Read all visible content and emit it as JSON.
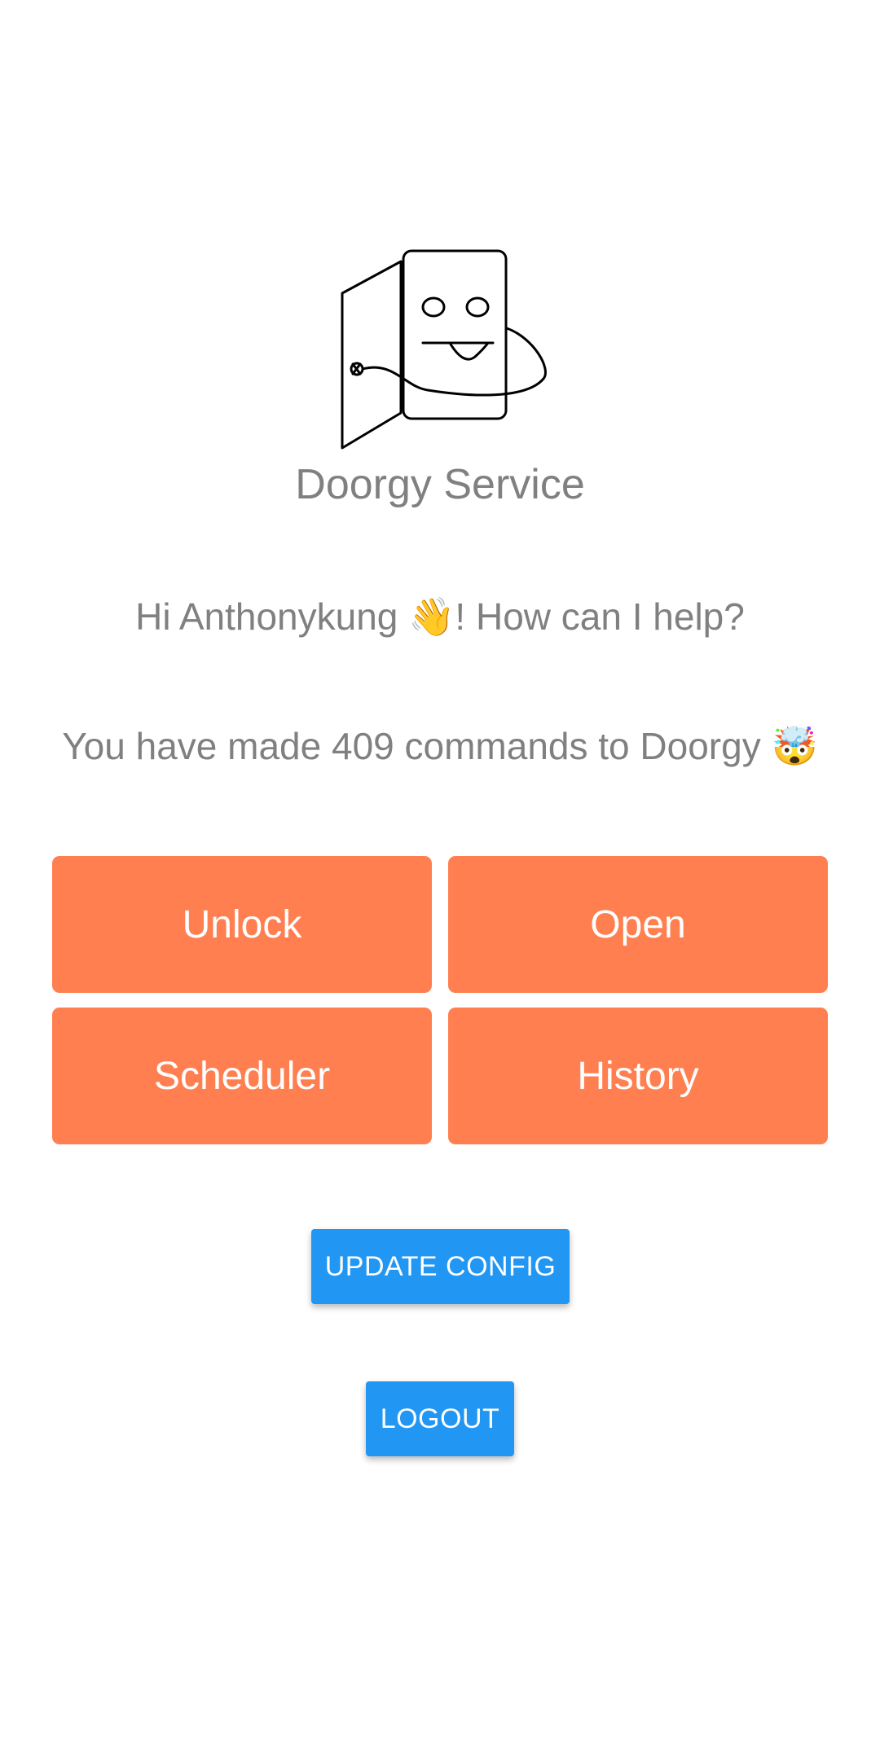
{
  "app": {
    "title": "Doorgy Service",
    "logo_icon": "door-face-logo-icon"
  },
  "greeting": {
    "text": "Hi Anthonykung 👋! How can I help?"
  },
  "stats": {
    "text": "You have made 409 commands to Doorgy 🤯"
  },
  "actions": {
    "unlock_label": "Unlock",
    "open_label": "Open",
    "scheduler_label": "Scheduler",
    "history_label": "History"
  },
  "buttons": {
    "update_config_label": "UPDATE CONFIG",
    "logout_label": "LOGOUT"
  },
  "colors": {
    "action_button": "#ff7f50",
    "primary_button": "#2196f3",
    "text_muted": "#808080"
  }
}
